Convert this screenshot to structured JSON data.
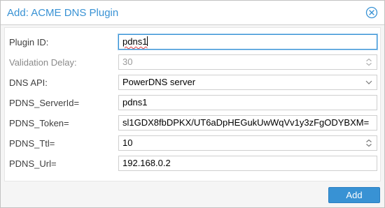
{
  "window": {
    "title": "Add: ACME DNS Plugin"
  },
  "form": {
    "plugin_id": {
      "label": "Plugin ID:",
      "value": "pdns1"
    },
    "validation_delay": {
      "label": "Validation Delay:",
      "value": "30"
    },
    "dns_api": {
      "label": "DNS API:",
      "value": "PowerDNS server"
    },
    "pdns_serverid": {
      "label": "PDNS_ServerId=",
      "value": "pdns1"
    },
    "pdns_token": {
      "label": "PDNS_Token=",
      "value": "sl1GDX8fbDPKX/UT6aDpHEGukUwWqVv1y3zFgODYBXM="
    },
    "pdns_ttl": {
      "label": "PDNS_Ttl=",
      "value": "10"
    },
    "pdns_url": {
      "label": "PDNS_Url=",
      "value": "192.168.0.2"
    }
  },
  "footer": {
    "add_label": "Add"
  },
  "icons": {
    "close": "close-circle-icon",
    "spinner": "spinner-arrows-icon",
    "dropdown": "chevron-down-icon"
  },
  "colors": {
    "accent": "#3892d4",
    "title": "#3892d4"
  }
}
